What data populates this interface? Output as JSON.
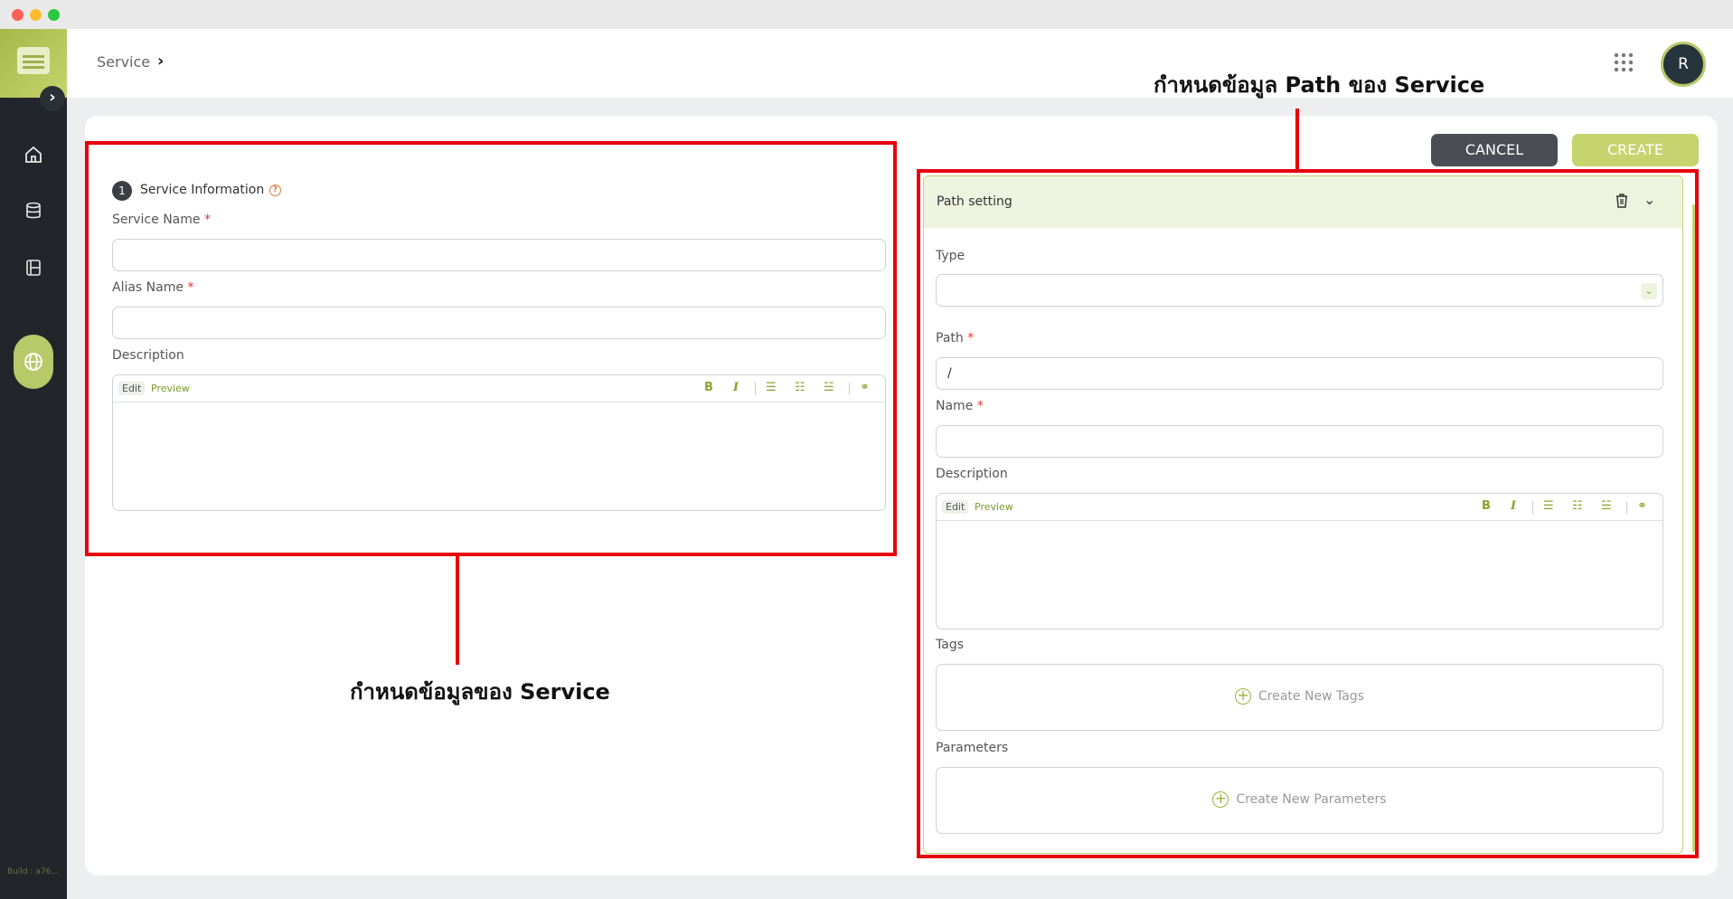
{
  "app": {
    "breadcrumb": "Service",
    "build": "Build : a76...",
    "avatar_initial": "R"
  },
  "sidebar": {
    "items": [
      "home-icon",
      "database-icon",
      "book-icon",
      "globe-icon"
    ]
  },
  "actions": {
    "cancel_label": "CANCEL",
    "create_label": "CREATE"
  },
  "service_info": {
    "number": "1",
    "title": "Service Information",
    "service_name_label": "Service Name",
    "alias_name_label": "Alias Name",
    "description_label": "Description",
    "required_mark": "*"
  },
  "editor": {
    "edit_tab": "Edit",
    "preview_tab": "Preview",
    "bold": "B",
    "italic": "I"
  },
  "path_setting": {
    "title": "Path setting",
    "type_label": "Type",
    "path_label": "Path",
    "path_value": "/",
    "name_label": "Name",
    "description_label": "Description",
    "tags_label": "Tags",
    "create_tags": "Create New Tags",
    "parameters_label": "Parameters",
    "create_parameters": "Create New Parameters"
  },
  "annotations": {
    "left": "กำหนดข้อมูลของ Service",
    "right": "กำหนดข้อมูล Path ของ Service"
  },
  "colors": {
    "accent": "#c5d46f",
    "annotation": "#e8000b",
    "sidebar": "#22262b"
  }
}
